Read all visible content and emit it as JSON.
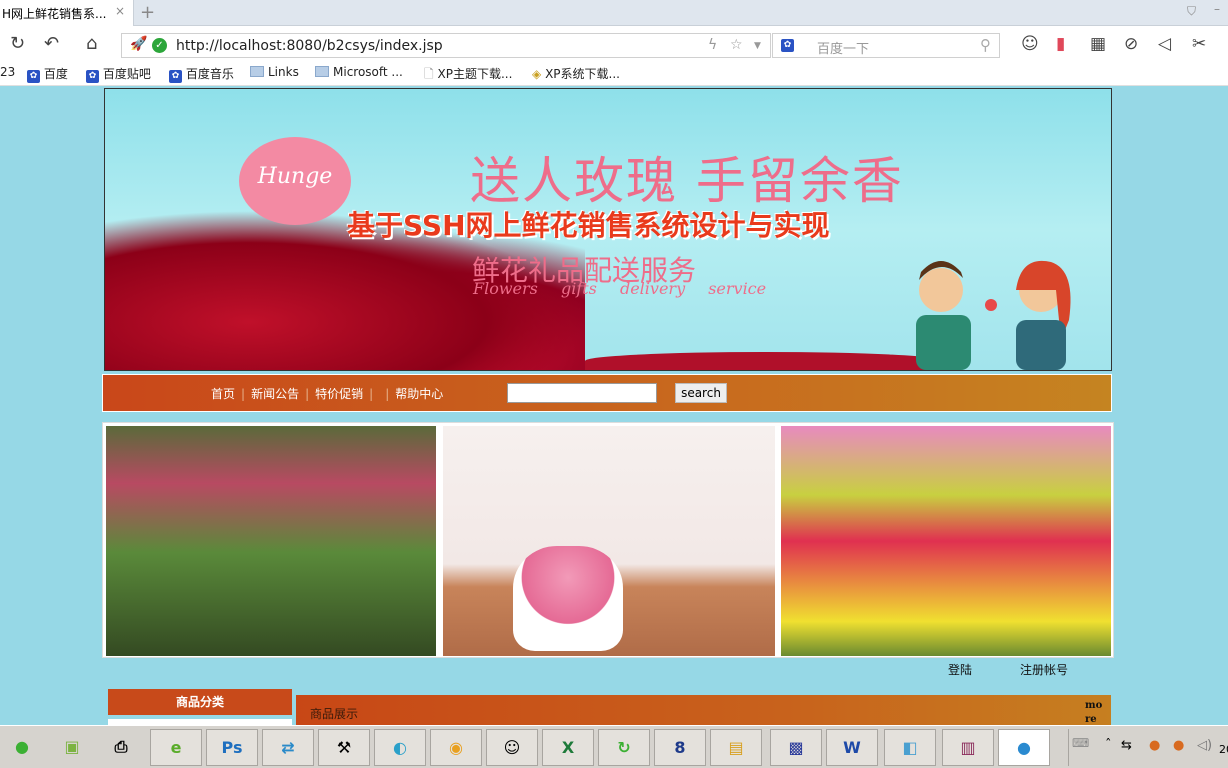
{
  "browser": {
    "tab_title": "H网上鲜花销售系...",
    "url": "http://localhost:8080/b2csys/index.jsp",
    "search_placeholder": "百度一下",
    "bookmarks": [
      {
        "label": "23",
        "icon": "none"
      },
      {
        "label": "百度",
        "icon": "baidu-paw"
      },
      {
        "label": "百度贴吧",
        "icon": "baidu-paw"
      },
      {
        "label": "百度音乐",
        "icon": "baidu-paw"
      },
      {
        "label": "Links",
        "icon": "folder"
      },
      {
        "label": "Microsoft ...",
        "icon": "folder"
      },
      {
        "label": "XP主题下载...",
        "icon": "page"
      },
      {
        "label": "XP系统下载...",
        "icon": "xp-logo"
      }
    ]
  },
  "banner": {
    "logo": "Hunge",
    "slogan": "送人玫瑰 手留余香",
    "title": "基于SSH网上鲜花销售系统设计与实现",
    "service": "鲜花礼品配送服务",
    "service_en": "Flowers gifts delivery service"
  },
  "nav": {
    "links": [
      "首页",
      "新闻公告",
      "特价促销",
      "帮助中心"
    ],
    "search_value": "",
    "search_button": "search"
  },
  "user": {
    "login": "登陆",
    "register": "注册帐号"
  },
  "sidebar": {
    "category_title": "商品分类"
  },
  "main": {
    "section_title": "商品展示",
    "more": "more"
  },
  "taskbar": {
    "apps": [
      "wechat",
      "android",
      "scanner",
      "ie",
      "photoshop",
      "network",
      "tools",
      "globe",
      "disk",
      "notes",
      "excel",
      "refresh",
      "app-8",
      "explorer",
      "media",
      "word",
      "eraser",
      "winrar",
      "browser"
    ],
    "clock_partial": "20"
  },
  "colors": {
    "page_bg": "#96d8e6",
    "nav_bar": "#c9471a",
    "category_header": "#c84a1a"
  }
}
